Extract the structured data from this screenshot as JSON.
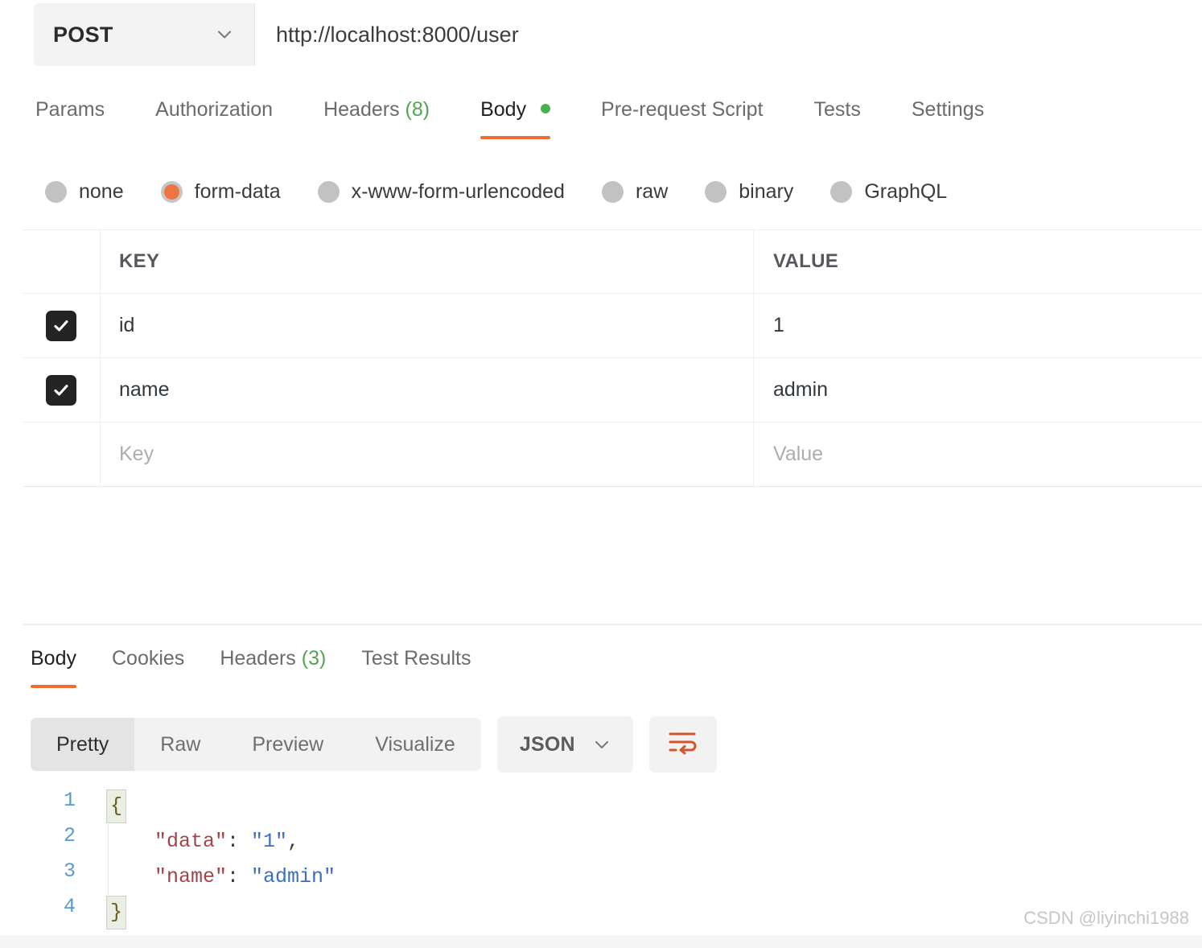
{
  "request": {
    "method": "POST",
    "url": "http://localhost:8000/user",
    "method_chevron_icon": "chevron-down-icon",
    "tabs": [
      {
        "label": "Params",
        "active": false
      },
      {
        "label": "Authorization",
        "active": false
      },
      {
        "label": "Headers",
        "count": "(8)",
        "active": false
      },
      {
        "label": "Body",
        "active": true,
        "indicator": "green-dot"
      },
      {
        "label": "Pre-request Script",
        "active": false
      },
      {
        "label": "Tests",
        "active": false
      },
      {
        "label": "Settings",
        "active": false
      }
    ],
    "body_types": [
      {
        "label": "none",
        "selected": false
      },
      {
        "label": "form-data",
        "selected": true
      },
      {
        "label": "x-www-form-urlencoded",
        "selected": false
      },
      {
        "label": "raw",
        "selected": false
      },
      {
        "label": "binary",
        "selected": false
      },
      {
        "label": "GraphQL",
        "selected": false
      }
    ],
    "table": {
      "columns": [
        "KEY",
        "VALUE"
      ],
      "rows": [
        {
          "checked": true,
          "key": "id",
          "value": "1"
        },
        {
          "checked": true,
          "key": "name",
          "value": "admin"
        }
      ],
      "placeholder_row": {
        "key": "Key",
        "value": "Value"
      },
      "checkbox_icon": "check-icon"
    }
  },
  "response": {
    "tabs": [
      {
        "label": "Body",
        "active": true
      },
      {
        "label": "Cookies",
        "active": false
      },
      {
        "label": "Headers",
        "count": "(3)",
        "active": false
      },
      {
        "label": "Test Results",
        "active": false
      }
    ],
    "view_modes": [
      {
        "label": "Pretty",
        "active": true
      },
      {
        "label": "Raw",
        "active": false
      },
      {
        "label": "Preview",
        "active": false
      },
      {
        "label": "Visualize",
        "active": false
      }
    ],
    "format": {
      "label": "JSON",
      "chevron_icon": "chevron-down-icon"
    },
    "wrap_button_icon": "wrap-lines-icon",
    "body_lines": [
      {
        "number": "1",
        "indent": 0,
        "brace": "{"
      },
      {
        "number": "2",
        "indent": 1,
        "key": "\"data\"",
        "sep": ": ",
        "value": "\"1\"",
        "tail": ","
      },
      {
        "number": "3",
        "indent": 1,
        "key": "\"name\"",
        "sep": ": ",
        "value": "\"admin\"",
        "tail": ""
      },
      {
        "number": "4",
        "indent": 0,
        "brace": "}"
      }
    ]
  },
  "watermark": "CSDN @liyinchi1988",
  "colors": {
    "accent_orange": "#ef6c33",
    "radio_selected": "#ef7445",
    "count_green": "#52a556",
    "indicator_green": "#4caf50",
    "checkbox_dark": "#242424",
    "json_key": "#a3434b",
    "json_string": "#3b6fc4",
    "line_number": "#5a9ad4"
  }
}
